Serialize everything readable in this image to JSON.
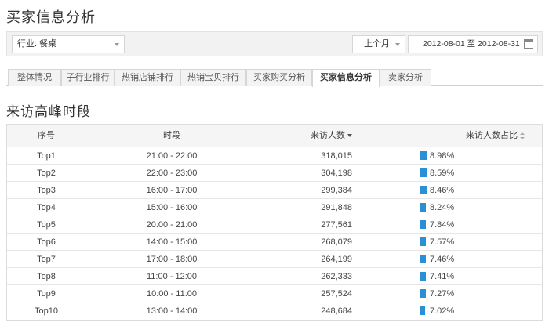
{
  "page_title": "买家信息分析",
  "filters": {
    "industry_label": "行业:",
    "industry_value": "餐桌",
    "period_value": "上个月",
    "date_start": "2012-08-01",
    "date_sep": "至",
    "date_end": "2012-08-31"
  },
  "tabs": [
    {
      "label": "整体情况",
      "active": false
    },
    {
      "label": "子行业排行",
      "active": false
    },
    {
      "label": "热销店铺排行",
      "active": false
    },
    {
      "label": "热销宝贝排行",
      "active": false
    },
    {
      "label": "买家购买分析",
      "active": false
    },
    {
      "label": "买家信息分析",
      "active": true
    },
    {
      "label": "卖家分析",
      "active": false
    }
  ],
  "section_title": "来访高峰时段",
  "table": {
    "headers": {
      "rank": "序号",
      "time": "时段",
      "visitors": "来访人数",
      "ratio": "来访人数占比"
    },
    "rows": [
      {
        "rank": "Top1",
        "time": "21:00 - 22:00",
        "visitors": "318,015",
        "ratio": "8.98%",
        "ratio_value": 8.98
      },
      {
        "rank": "Top2",
        "time": "22:00 - 23:00",
        "visitors": "304,198",
        "ratio": "8.59%",
        "ratio_value": 8.59
      },
      {
        "rank": "Top3",
        "time": "16:00 - 17:00",
        "visitors": "299,384",
        "ratio": "8.46%",
        "ratio_value": 8.46
      },
      {
        "rank": "Top4",
        "time": "15:00 - 16:00",
        "visitors": "291,848",
        "ratio": "8.24%",
        "ratio_value": 8.24
      },
      {
        "rank": "Top5",
        "time": "20:00 - 21:00",
        "visitors": "277,561",
        "ratio": "7.84%",
        "ratio_value": 7.84
      },
      {
        "rank": "Top6",
        "time": "14:00 - 15:00",
        "visitors": "268,079",
        "ratio": "7.57%",
        "ratio_value": 7.57
      },
      {
        "rank": "Top7",
        "time": "17:00 - 18:00",
        "visitors": "264,199",
        "ratio": "7.46%",
        "ratio_value": 7.46
      },
      {
        "rank": "Top8",
        "time": "11:00 - 12:00",
        "visitors": "262,333",
        "ratio": "7.41%",
        "ratio_value": 7.41
      },
      {
        "rank": "Top9",
        "time": "10:00 - 11:00",
        "visitors": "257,524",
        "ratio": "7.27%",
        "ratio_value": 7.27
      },
      {
        "rank": "Top10",
        "time": "13:00 - 14:00",
        "visitors": "248,684",
        "ratio": "7.02%",
        "ratio_value": 7.02
      }
    ]
  },
  "colors": {
    "ratio_bar": "#2b8fd3"
  }
}
